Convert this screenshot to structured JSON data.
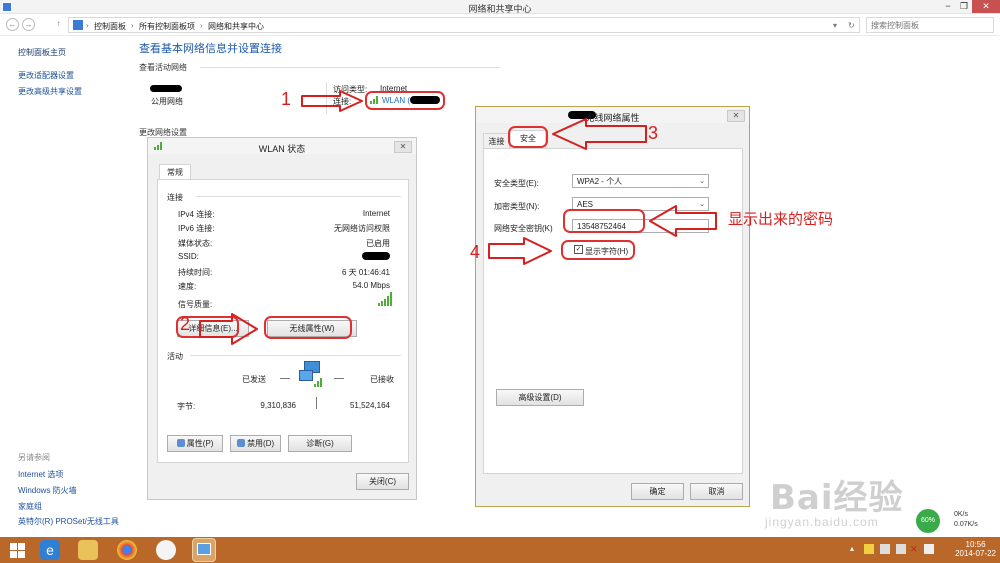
{
  "window": {
    "title": "网络和共享中心",
    "minimize": "−",
    "restore": "❐",
    "close": "✕"
  },
  "nav": {
    "back": "←",
    "forward": "→",
    "up": "↑",
    "crumbs": [
      "控制面板",
      "所有控制面板项",
      "网络和共享中心"
    ],
    "sep": "›",
    "search_placeholder": "搜索控制面板",
    "refresh": "↻",
    "dropdown": "▾"
  },
  "left": {
    "home": "控制面板主页",
    "adapter": "更改适配器设置",
    "advanced": "更改高级共享设置",
    "see_also": "另请参阅",
    "see": [
      "Internet 选项",
      "Windows 防火墙",
      "家庭组",
      "英特尔(R) PROSet/无线工具"
    ]
  },
  "main": {
    "heading": "查看基本网络信息并设置连接",
    "active": "查看活动网络",
    "network_type": "公用网络",
    "access_label": "访问类型:",
    "access_value": "Internet",
    "conn_label": "连接:",
    "conn_value": "WLAN (",
    "change": "更改网络设置"
  },
  "wlan_status": {
    "title": "WLAN 状态",
    "tab": "常规",
    "connection": "连接",
    "rows": [
      {
        "k": "IPv4 连接:",
        "v": "Internet"
      },
      {
        "k": "IPv6 连接:",
        "v": "无网络访问权限"
      },
      {
        "k": "媒体状态:",
        "v": "已启用"
      },
      {
        "k": "SSID:",
        "v": ""
      },
      {
        "k": "持续时间:",
        "v": "6 天 01:46:41"
      },
      {
        "k": "速度:",
        "v": "54.0 Mbps"
      }
    ],
    "signal": "信号质量:",
    "details_btn": "详细信息(E)...",
    "wireless_btn": "无线属性(W)",
    "activity": "活动",
    "sent": "已发送",
    "recv": "已接收",
    "bytes": "字节:",
    "sent_bytes": "9,310,836",
    "recv_bytes": "51,524,164",
    "props_btn": "属性(P)",
    "disable_btn": "禁用(D)",
    "diag_btn": "诊断(G)",
    "close_btn": "关闭(C)"
  },
  "wprops": {
    "title": "无线网络属性",
    "tab_conn": "连接",
    "tab_sec": "安全",
    "sec_type_label": "安全类型(E):",
    "sec_type": "WPA2 - 个人",
    "enc_label": "加密类型(N):",
    "enc": "AES",
    "key_label": "网络安全密钥(K)",
    "key": "13548752464",
    "show": "显示字符(H)",
    "advanced": "高级设置(D)",
    "ok": "确定",
    "cancel": "取消",
    "check": "✓"
  },
  "annotations": {
    "n1": "1",
    "n2": "2",
    "n3": "3",
    "n4": "4",
    "note": "显示出来的密码"
  },
  "taskbar": {
    "time": "10:56",
    "date": "2014-07-22"
  },
  "net_widget": {
    "pct": "60%",
    "up": "0K/s",
    "down": "0.07K/s"
  },
  "watermark": {
    "brand": "Bai经验",
    "url": "jingyan.baidu.com"
  }
}
